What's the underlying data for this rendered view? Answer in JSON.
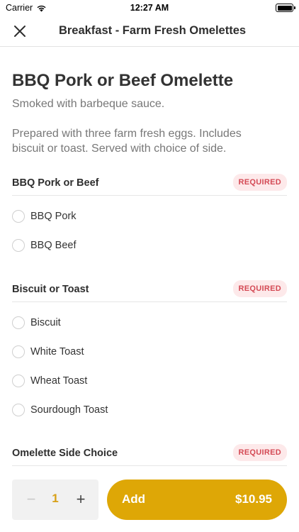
{
  "status_bar": {
    "carrier": "Carrier",
    "time": "12:27 AM"
  },
  "nav": {
    "title": "Breakfast - Farm Fresh Omelettes"
  },
  "item": {
    "title": "BBQ Pork or Beef Omelette",
    "subtitle": "Smoked with barbeque sauce.",
    "description": "Prepared with three farm fresh eggs. Includes biscuit or toast. Served with choice of side."
  },
  "groups": [
    {
      "title": "BBQ Pork or Beef",
      "badge": "REQUIRED",
      "options": [
        "BBQ Pork",
        "BBQ Beef"
      ]
    },
    {
      "title": "Biscuit or Toast",
      "badge": "REQUIRED",
      "options": [
        "Biscuit",
        "White Toast",
        "Wheat Toast",
        "Sourdough Toast"
      ]
    },
    {
      "title": "Omelette Side Choice",
      "badge": "REQUIRED",
      "options": []
    }
  ],
  "footer": {
    "minus": "−",
    "quantity": "1",
    "plus": "+",
    "add_label": "Add",
    "price": "$10.95"
  },
  "colors": {
    "accent": "#dea706",
    "badge_bg": "#fde9ea",
    "badge_text": "#d44a55"
  }
}
